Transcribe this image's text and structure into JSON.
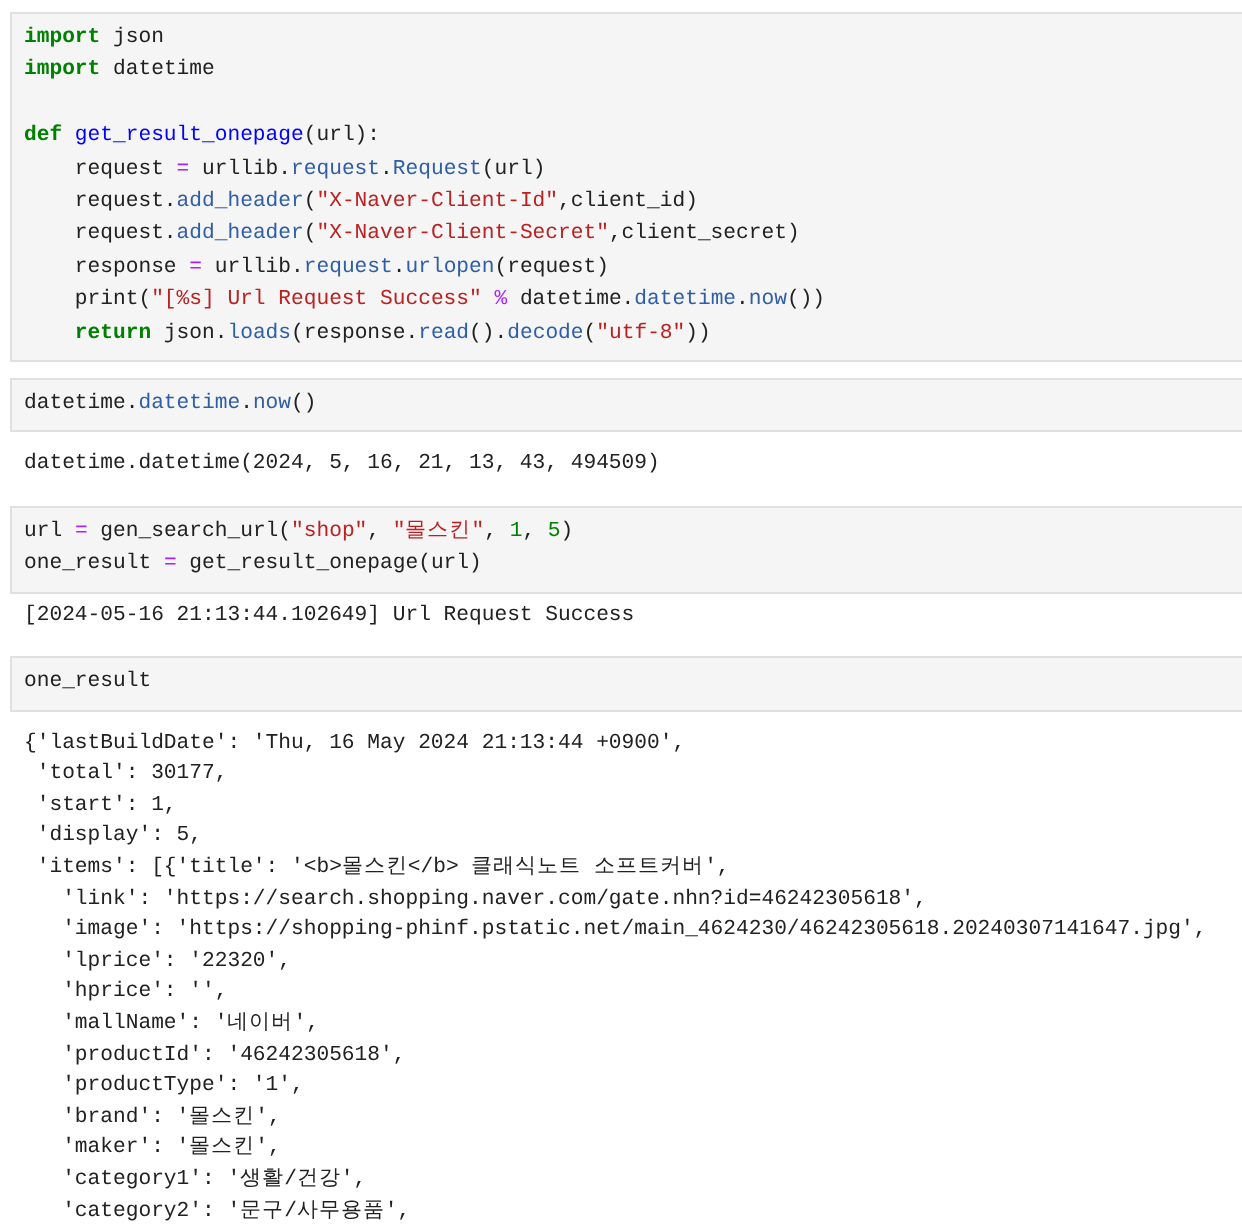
{
  "cells": [
    {
      "input": [
        {
          "tokens": [
            {
              "kind": "keyword",
              "text": "import"
            },
            {
              "kind": "plain",
              "text": " json"
            }
          ]
        },
        {
          "tokens": [
            {
              "kind": "keyword",
              "text": "import"
            },
            {
              "kind": "plain",
              "text": " datetime"
            }
          ]
        },
        {
          "blank_before": true,
          "tokens": [
            {
              "kind": "keyword",
              "text": "def"
            },
            {
              "kind": "defname",
              "text": " get_result_onepage"
            },
            {
              "kind": "plain",
              "text": "(url):"
            }
          ]
        },
        {
          "tokens": [
            {
              "kind": "plain",
              "text": "    request "
            },
            {
              "kind": "op",
              "text": "="
            },
            {
              "kind": "plain",
              "text": " urllib."
            },
            {
              "kind": "attr",
              "text": "request"
            },
            {
              "kind": "plain",
              "text": "."
            },
            {
              "kind": "attr",
              "text": "Request"
            },
            {
              "kind": "plain",
              "text": "(url)"
            }
          ]
        },
        {
          "tokens": [
            {
              "kind": "plain",
              "text": "    request."
            },
            {
              "kind": "attr",
              "text": "add_header"
            },
            {
              "kind": "plain",
              "text": "("
            },
            {
              "kind": "string",
              "text": "\"X-Naver-Client-Id\""
            },
            {
              "kind": "plain",
              "text": ",client_id)"
            }
          ]
        },
        {
          "tokens": [
            {
              "kind": "plain",
              "text": "    request."
            },
            {
              "kind": "attr",
              "text": "add_header"
            },
            {
              "kind": "plain",
              "text": "("
            },
            {
              "kind": "string",
              "text": "\"X-Naver-Client-Secret\""
            },
            {
              "kind": "plain",
              "text": ",client_secret)"
            }
          ]
        },
        {
          "tokens": [
            {
              "kind": "plain",
              "text": "    response "
            },
            {
              "kind": "op",
              "text": "="
            },
            {
              "kind": "plain",
              "text": " urllib."
            },
            {
              "kind": "attr",
              "text": "request"
            },
            {
              "kind": "plain",
              "text": "."
            },
            {
              "kind": "attr",
              "text": "urlopen"
            },
            {
              "kind": "plain",
              "text": "(request)"
            }
          ]
        },
        {
          "tokens": [
            {
              "kind": "plain",
              "text": "    print("
            },
            {
              "kind": "string",
              "text": "\"[%s] Url Request Success\""
            },
            {
              "kind": "op",
              "text": " %"
            },
            {
              "kind": "plain",
              "text": " datetime."
            },
            {
              "kind": "attr",
              "text": "datetime"
            },
            {
              "kind": "plain",
              "text": "."
            },
            {
              "kind": "attr",
              "text": "now"
            },
            {
              "kind": "plain",
              "text": "())"
            }
          ]
        },
        {
          "tokens": [
            {
              "kind": "keyword",
              "text": "    return"
            },
            {
              "kind": "plain",
              "text": " json."
            },
            {
              "kind": "attr",
              "text": "loads"
            },
            {
              "kind": "plain",
              "text": "(response."
            },
            {
              "kind": "attr",
              "text": "read"
            },
            {
              "kind": "plain",
              "text": "()."
            },
            {
              "kind": "attr",
              "text": "decode"
            },
            {
              "kind": "plain",
              "text": "("
            },
            {
              "kind": "string",
              "text": "\"utf-8\""
            },
            {
              "kind": "plain",
              "text": "))"
            }
          ]
        }
      ]
    },
    {
      "input": [
        {
          "tokens": [
            {
              "kind": "plain",
              "text": "datetime."
            },
            {
              "kind": "attr",
              "text": "datetime"
            },
            {
              "kind": "plain",
              "text": "."
            },
            {
              "kind": "attr",
              "text": "now"
            },
            {
              "kind": "plain",
              "text": "()"
            }
          ]
        }
      ],
      "output": {
        "kind": "result",
        "lines": [
          "datetime.datetime(2024, 5, 16, 21, 13, 43, 494509)"
        ]
      }
    },
    {
      "input": [
        {
          "tokens": [
            {
              "kind": "plain",
              "text": "url "
            },
            {
              "kind": "op",
              "text": "="
            },
            {
              "kind": "plain",
              "text": " gen_search_url("
            },
            {
              "kind": "string",
              "text": "\"shop\""
            },
            {
              "kind": "plain",
              "text": ", "
            },
            {
              "kind": "string",
              "text": "\"몰스킨\""
            },
            {
              "kind": "plain",
              "text": ", "
            },
            {
              "kind": "number",
              "text": "1"
            },
            {
              "kind": "plain",
              "text": ", "
            },
            {
              "kind": "number",
              "text": "5"
            },
            {
              "kind": "plain",
              "text": ")"
            }
          ]
        },
        {
          "tokens": [
            {
              "kind": "plain",
              "text": "one_result "
            },
            {
              "kind": "op",
              "text": "="
            },
            {
              "kind": "plain",
              "text": " get_result_onepage(url)"
            }
          ]
        }
      ],
      "output": {
        "kind": "stream",
        "lines": [
          "[2024-05-16 21:13:44.102649] Url Request Success"
        ]
      }
    },
    {
      "input": [
        {
          "tokens": [
            {
              "kind": "plain",
              "text": "one_result"
            }
          ]
        }
      ],
      "output": {
        "kind": "result",
        "lines": [
          "{'lastBuildDate': 'Thu, 16 May 2024 21:13:44 +0900',",
          " 'total': 30177,",
          " 'start': 1,",
          " 'display': 5,",
          " 'items': [{'title': '<b>몰스킨</b> 클래식노트 소프트커버',",
          "   'link': 'https://search.shopping.naver.com/gate.nhn?id=46242305618',",
          "   'image': 'https://shopping-phinf.pstatic.net/main_4624230/46242305618.20240307141647.jpg',",
          "   'lprice': '22320',",
          "   'hprice': '',",
          "   'mallName': '네이버',",
          "   'productId': '46242305618',",
          "   'productType': '1',",
          "   'brand': '몰스킨',",
          "   'maker': '몰스킨',",
          "   'category1': '생활/건강',",
          "   'category2': '문구/사무용품',"
        ]
      }
    }
  ]
}
